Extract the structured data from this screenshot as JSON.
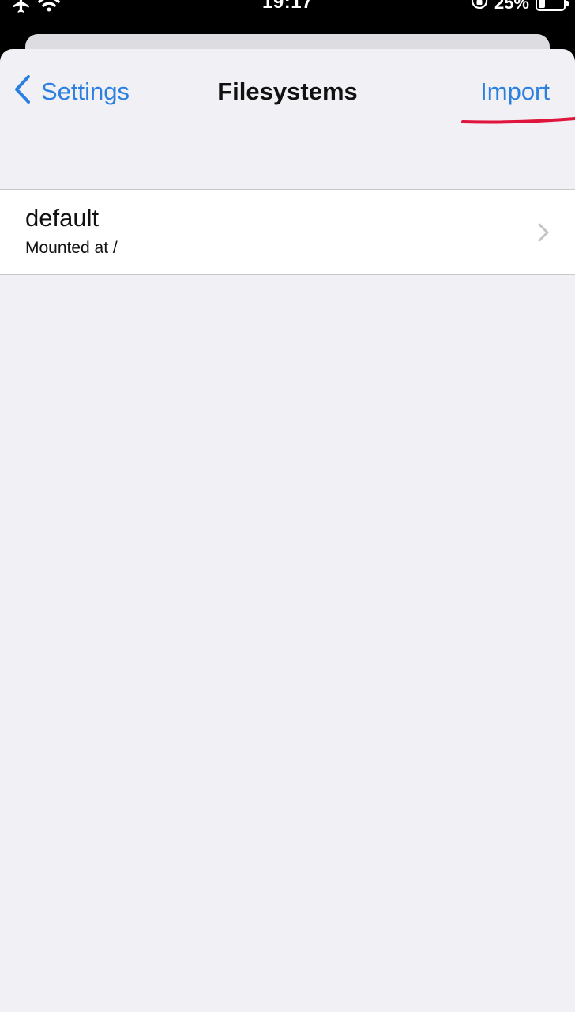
{
  "status_bar": {
    "time": "19:17",
    "battery_percent_label": "25%",
    "battery_level": 0.25,
    "icons": [
      "airplane-icon",
      "wifi-icon",
      "rotation-lock-icon",
      "battery-icon"
    ]
  },
  "nav": {
    "back_label": "Settings",
    "title": "Filesystems",
    "import_label": "Import",
    "annotation_color": "#e0153c"
  },
  "filesystems": [
    {
      "name": "default",
      "subtitle": "Mounted at /"
    }
  ],
  "colors": {
    "accent": "#2b7fe0",
    "background": "#f0f0f5",
    "row": "#ffffff",
    "separator": "#c8c8cc"
  }
}
